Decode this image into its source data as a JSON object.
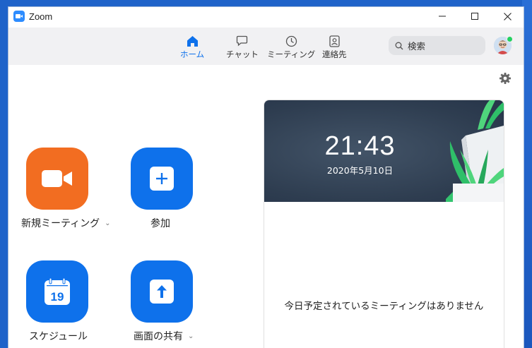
{
  "window": {
    "title": "Zoom"
  },
  "titlebar_controls": {
    "minimize_icon": "minimize-icon",
    "maximize_icon": "maximize-icon",
    "close_icon": "close-icon"
  },
  "nav": {
    "items": [
      {
        "label": "ホーム",
        "icon": "home-icon",
        "active": true
      },
      {
        "label": "チャット",
        "icon": "chat-icon",
        "active": false
      },
      {
        "label": "ミーティング",
        "icon": "clock-icon",
        "active": false
      },
      {
        "label": "連絡先",
        "icon": "contacts-icon",
        "active": false
      }
    ]
  },
  "search": {
    "placeholder": "検索"
  },
  "profile": {
    "status": "online",
    "status_color": "#23d160"
  },
  "actions": [
    {
      "label": "新規ミーティング",
      "icon": "video-camera-icon",
      "color": "#f26d21",
      "has_dropdown": true
    },
    {
      "label": "参加",
      "icon": "plus-icon",
      "color": "#0e71eb",
      "has_dropdown": false
    },
    {
      "label": "スケジュール",
      "icon": "calendar-icon",
      "icon_text": "19",
      "color": "#0e71eb",
      "has_dropdown": false
    },
    {
      "label": "画面の共有",
      "icon": "share-screen-icon",
      "color": "#0e71eb",
      "has_dropdown": true
    }
  ],
  "clock_card": {
    "time": "21:43",
    "date": "2020年5月10日",
    "empty_message": "今日予定されているミーティングはありません"
  },
  "colors": {
    "accent": "#0e71eb",
    "orange": "#f26d21",
    "banner": "#2e3d50"
  }
}
